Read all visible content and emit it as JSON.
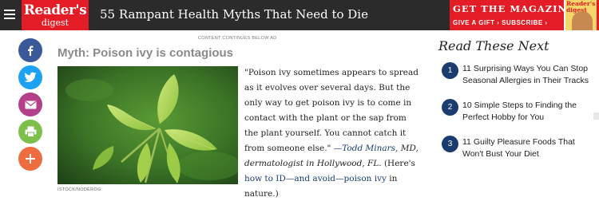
{
  "header": {
    "logo_line1": "Reader's",
    "logo_line2": "digest",
    "headline": "55 Rampant Health Myths That Need to Die",
    "promo_title": "GET THE MAGAZINE",
    "promo_sub": "GIVE A GIFT › SUBSCRIBE ›",
    "cover_title": "Reader's digest"
  },
  "social": [
    "facebook-icon",
    "twitter-icon",
    "email-icon",
    "print-icon",
    "plus-icon"
  ],
  "article": {
    "ad_note": "CONTENT CONTINUES BELOW AD",
    "myth_title": "Myth: Poison ivy is contagious",
    "photo_credit": "ISTOCK/NODEROG",
    "quote_text": "\"Poison ivy sometimes appears to spread as it evolves over several days. But the only way to get poison ivy is to come in contact with the plant or the sap from the plant yourself. You cannot catch it from someone else.\" ",
    "attribution": "—Todd Minars,",
    "attribution_rest": " MD, dermatologist in Hollywood, FL.",
    "here_text": " (Here's ",
    "link_text": "how to ID—and avoid—poison ivy",
    "tail_text": " in nature.)"
  },
  "sidebar": {
    "title": "Read These Next",
    "items": [
      {
        "num": "1",
        "text": "11 Surprising Ways You Can Stop Seasonal Allergies in Their Tracks"
      },
      {
        "num": "2",
        "text": "10 Simple Steps to Finding the Perfect Hobby for You"
      },
      {
        "num": "3",
        "text": "11 Guilty Pleasure Foods That Won't Bust Your Diet"
      }
    ]
  },
  "colors": {
    "brand_red": "#e31c25",
    "header_bg": "#2b2b2b",
    "link_navy": "#1b3c6e",
    "facebook": "#3b5998",
    "twitter": "#1da1f2",
    "email": "#b5408a",
    "print": "#7cc04b",
    "plus": "#ef6c3e"
  }
}
